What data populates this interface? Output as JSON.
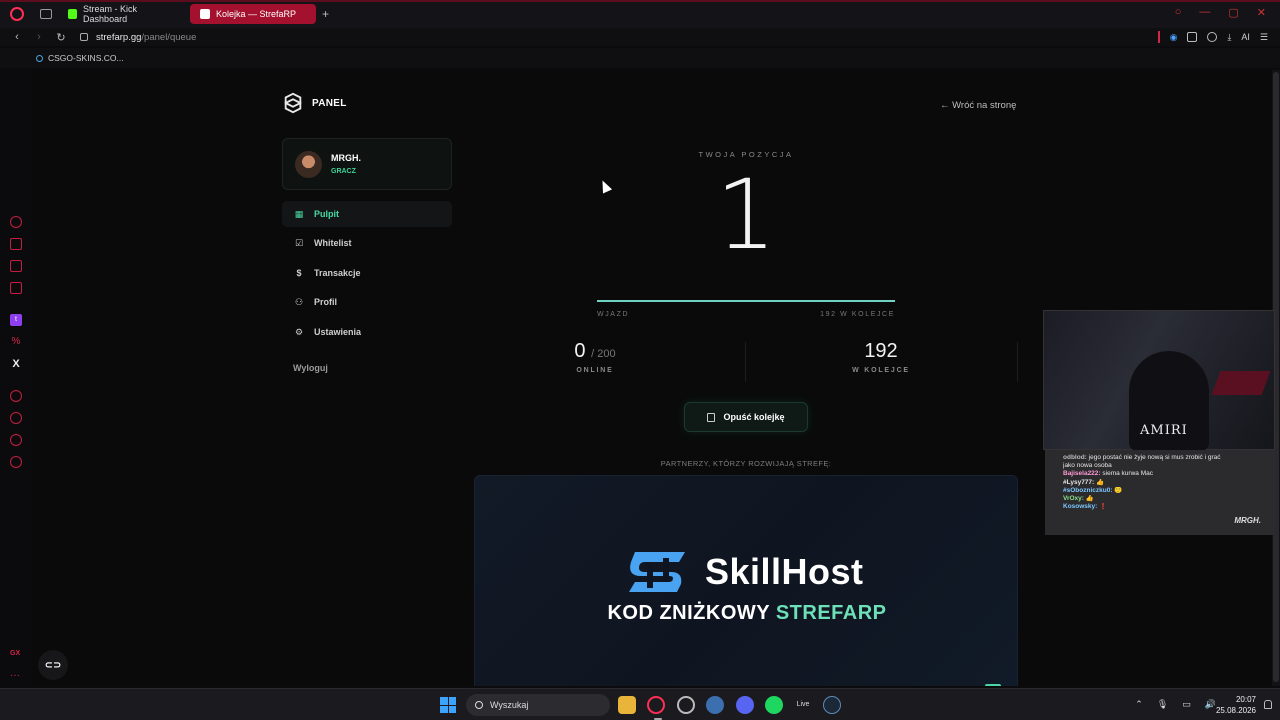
{
  "browser": {
    "tabs": [
      {
        "label": "Stream - Kick Dashboard",
        "active": false,
        "favicon_color": "#53fc18"
      },
      {
        "label": "Kolejka — StrefaRP",
        "active": true,
        "favicon_color": "#ffffff"
      }
    ],
    "new_tab": "+",
    "url_host": "strefarp.gg",
    "url_path": "/panel/queue",
    "ai_label": "AI",
    "bookmarks": [
      {
        "label": "CSGO-SKINS.CO..."
      }
    ],
    "accent_color": "#d6254b"
  },
  "opera_sidebar": {
    "gx_label": "GX",
    "more_label": "···"
  },
  "panel": {
    "logo_text": "PANEL",
    "back_link": "← Wróć na stronę",
    "user": {
      "name": "MRGH.",
      "role": "GRACZ"
    },
    "menu": [
      {
        "label": "Pulpit",
        "icon": "grid-icon",
        "glyph": "▦",
        "active": true
      },
      {
        "label": "Whitelist",
        "icon": "checkbox-icon",
        "glyph": "☑",
        "active": false
      },
      {
        "label": "Transakcje",
        "icon": "dollar-icon",
        "glyph": "$",
        "active": false
      },
      {
        "label": "Profil",
        "icon": "user-icon",
        "glyph": "⚇",
        "active": false
      },
      {
        "label": "Ustawienia",
        "icon": "sliders-icon",
        "glyph": "⚙",
        "active": false
      }
    ],
    "logout": "Wyloguj",
    "accent_color": "#46d9a1"
  },
  "queue": {
    "position_label": "TWOJA POZYCJA",
    "position": "1",
    "progress_fraction": 1.0,
    "left_label": "WJAZD",
    "right_label": "192 W KOLEJCE",
    "online_value": "0",
    "online_max": "/ 200",
    "online_label": "ONLINE",
    "queue_value": "192",
    "queue_label": "W KOLEJCE",
    "leave_button": "Opuść kolejkę",
    "partners_label": "PARTNERZY, KTÓRZY ROZWIJAJĄ STREFĘ:"
  },
  "banner": {
    "brand": "SkillHost",
    "code_prefix": "KOD ZNIŻKOWY ",
    "code": "STREFARP",
    "brand_color": "#6de0b8"
  },
  "stream_overlay": {
    "cam_brand": "AMIRI",
    "signature": "MRGH.",
    "chat": [
      {
        "user": "odblod:",
        "text": "jego postać nie żyje nową si mus zrobić i grać",
        "color": "#bbbbbb"
      },
      {
        "user": "",
        "text": "jako nowa osoba",
        "color": "#e6e6e6"
      },
      {
        "user": "Bajisela222:",
        "text": "siema kurwa Mac",
        "color": "#ff9ad5"
      },
      {
        "user": "#Lysy777:",
        "text": "👍",
        "color": "#e6e6e6"
      },
      {
        "user": "#sObozniczku0:",
        "text": "🙂",
        "color": "#7ec8ff"
      },
      {
        "user": "VrOxy:",
        "text": "👍",
        "color": "#8be08b"
      },
      {
        "user": "Kosowsky:",
        "text": "❗",
        "color": "#7ec8ff"
      }
    ]
  },
  "taskbar": {
    "search_placeholder": "Wyszukaj",
    "time": "20:07",
    "date": "25.08.2026",
    "live_label": "Live"
  }
}
